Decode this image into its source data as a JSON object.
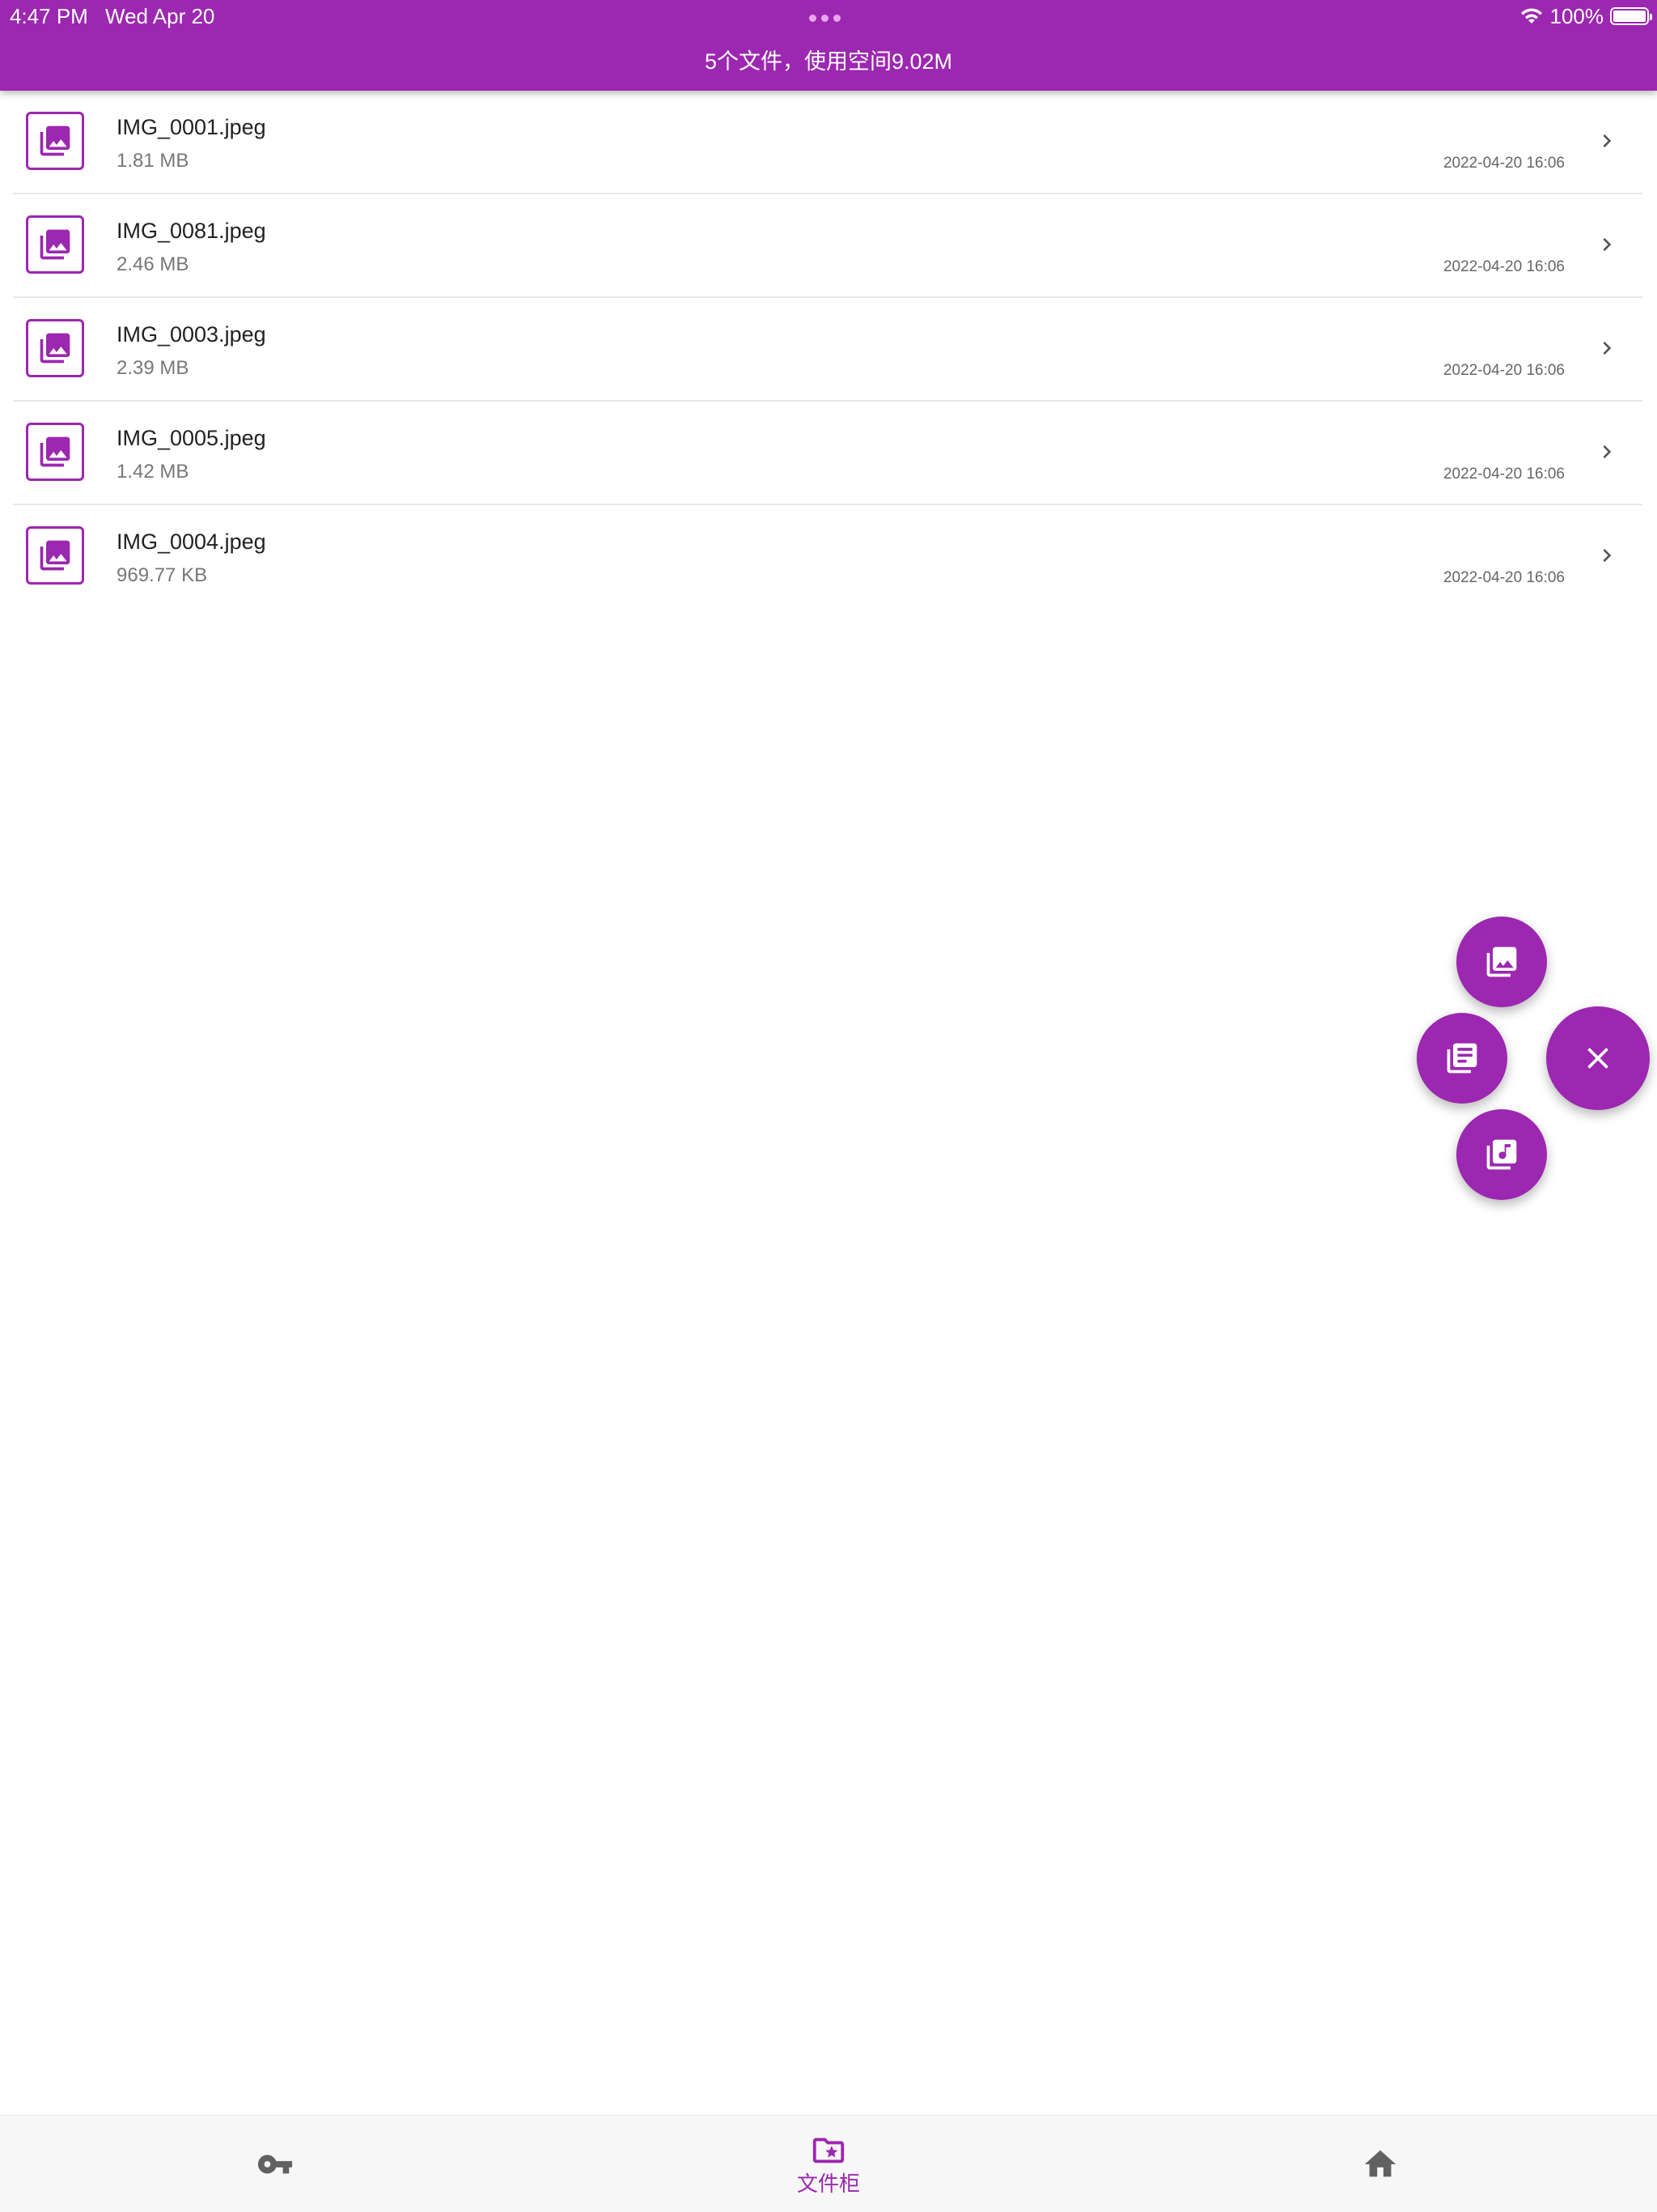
{
  "status_bar": {
    "time": "4:47 PM",
    "date": "Wed Apr 20",
    "wifi_icon": "wifi-icon",
    "battery_percent": "100%",
    "battery_level": 1.0
  },
  "header": {
    "title": "5个文件，使用空间9.02M"
  },
  "files": [
    {
      "name": "IMG_0001.jpeg",
      "size": "1.81 MB",
      "date": "2022-04-20 16:06",
      "icon": "photo-library-icon"
    },
    {
      "name": "IMG_0081.jpeg",
      "size": "2.46 MB",
      "date": "2022-04-20 16:06",
      "icon": "photo-library-icon"
    },
    {
      "name": "IMG_0003.jpeg",
      "size": "2.39 MB",
      "date": "2022-04-20 16:06",
      "icon": "photo-library-icon"
    },
    {
      "name": "IMG_0005.jpeg",
      "size": "1.42 MB",
      "date": "2022-04-20 16:06",
      "icon": "photo-library-icon"
    },
    {
      "name": "IMG_0004.jpeg",
      "size": "969.77 KB",
      "date": "2022-04-20 16:06",
      "icon": "photo-library-icon"
    }
  ],
  "fab_menu": {
    "items": [
      {
        "icon": "photo-library-icon"
      },
      {
        "icon": "document-library-icon"
      },
      {
        "icon": "music-library-icon"
      }
    ],
    "close_icon": "close-icon"
  },
  "bottom_nav": {
    "items": [
      {
        "icon": "key-icon",
        "label": ""
      },
      {
        "icon": "folder-star-icon",
        "label": "文件柜",
        "active": true
      },
      {
        "icon": "home-icon",
        "label": ""
      }
    ]
  },
  "colors": {
    "primary": "#9c27b0",
    "inactive_icon": "#616161",
    "divider": "#e8e8e8"
  }
}
